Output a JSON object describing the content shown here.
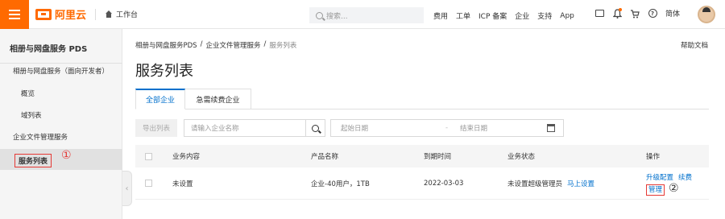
{
  "topbar": {
    "logo_text": "阿里云",
    "workbench_label": "工作台",
    "search_placeholder": "搜索...",
    "nav": [
      "费用",
      "工单",
      "ICP 备案",
      "企业",
      "支持",
      "App"
    ],
    "lang": "简体"
  },
  "sidebar": {
    "title": "相册与网盘服务 PDS",
    "items": [
      {
        "label": "相册与网盘服务（面向开发者）"
      },
      {
        "label": "概览"
      },
      {
        "label": "域列表"
      },
      {
        "label": "企业文件管理服务"
      },
      {
        "label": "服务列表"
      }
    ],
    "marker": "①",
    "collapse_glyph": "‹"
  },
  "breadcrumb": {
    "items": [
      "相册与网盘服务PDS",
      "企业文件管理服务",
      "服务列表"
    ],
    "sep": "/"
  },
  "help_doc": "帮助文档",
  "page_title": "服务列表",
  "tabs": [
    {
      "label": "全部企业",
      "active": true
    },
    {
      "label": "急需续费企业",
      "active": false
    }
  ],
  "toolbar": {
    "export_label": "导出列表",
    "enterprise_placeholder": "请输入企业名称",
    "start_date_placeholder": "起始日期",
    "date_sep": "-",
    "end_date_placeholder": "结束日期"
  },
  "table": {
    "columns": [
      "业务内容",
      "产品名称",
      "到期时间",
      "业务状态",
      "操作"
    ],
    "rows": [
      {
        "content": "未设置",
        "product": "企业-40用户，1TB",
        "expire": "2022-03-03",
        "status": "未设置超级管理员",
        "status_link": "马上设置",
        "ops": [
          "升级配置",
          "续费",
          "管理"
        ]
      }
    ],
    "marker": "②"
  },
  "colors": {
    "brand": "#ff6a00",
    "link": "#0070cc",
    "highlight": "#e53935"
  }
}
